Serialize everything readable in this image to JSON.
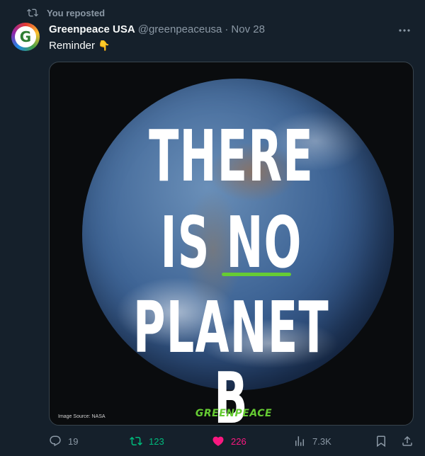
{
  "repost": {
    "label": "You reposted",
    "icon": "repost-icon"
  },
  "author": {
    "name": "Greenpeace USA",
    "handle": "@greenpeaceusa",
    "separator": "·",
    "date": "Nov 28",
    "avatar_letter": "G"
  },
  "tweet": {
    "text": "Reminder",
    "emoji": "👇"
  },
  "media": {
    "line1": "THERE",
    "line2": "IS NO",
    "line3": "PLANET B",
    "source": "Image Source: NASA",
    "logo": "GREENPEACE"
  },
  "actions": {
    "replies": "19",
    "reposts": "123",
    "likes": "226",
    "views": "7.3K"
  },
  "colors": {
    "background": "#15202b",
    "muted": "#8b98a5",
    "repost_active": "#00ba7c",
    "like_active": "#f91880",
    "greenpeace_green": "#66cc33"
  }
}
